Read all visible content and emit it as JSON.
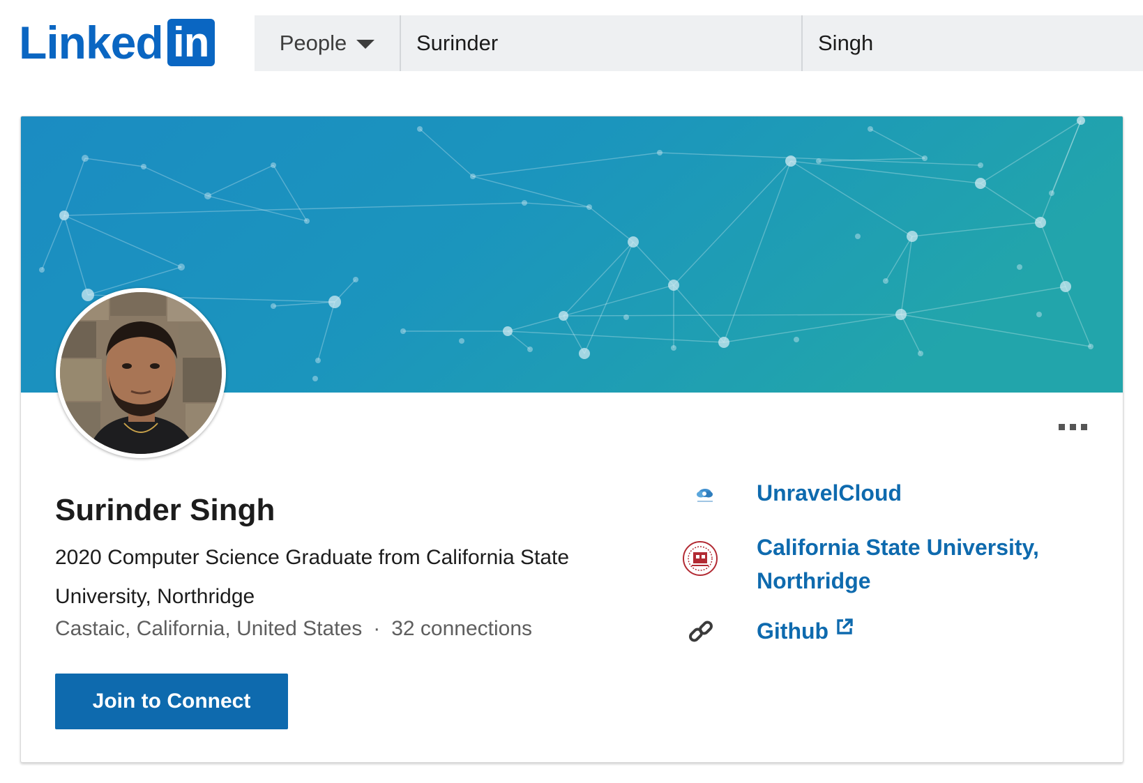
{
  "header": {
    "logo_text": "Linked",
    "logo_box_text": "in",
    "search": {
      "type_label": "People",
      "first_name_value": "Surinder",
      "last_name_value": "Singh"
    }
  },
  "profile": {
    "name": "Surinder Singh",
    "headline": "2020 Computer Science Graduate from California State University, Northridge",
    "location": "Castaic, California, United States",
    "separator": "·",
    "connections": "32 connections",
    "join_label": "Join to Connect",
    "more_menu_icon": "more-horizontal-icon"
  },
  "side_links": [
    {
      "label": "UnravelCloud",
      "icon": "unravelcloud-logo"
    },
    {
      "label": "California State University, Northridge",
      "icon": "csun-seal"
    },
    {
      "label": "Github",
      "icon": "link-icon",
      "external_icon": "external-link-icon"
    }
  ],
  "colors": {
    "brand_blue": "#0e6aae",
    "logo_blue": "#0a66c2",
    "banner_start": "#1d8fc1",
    "banner_end": "#21a3ad",
    "search_bg": "#eef0f2",
    "meta_text": "#5e5e5e"
  }
}
